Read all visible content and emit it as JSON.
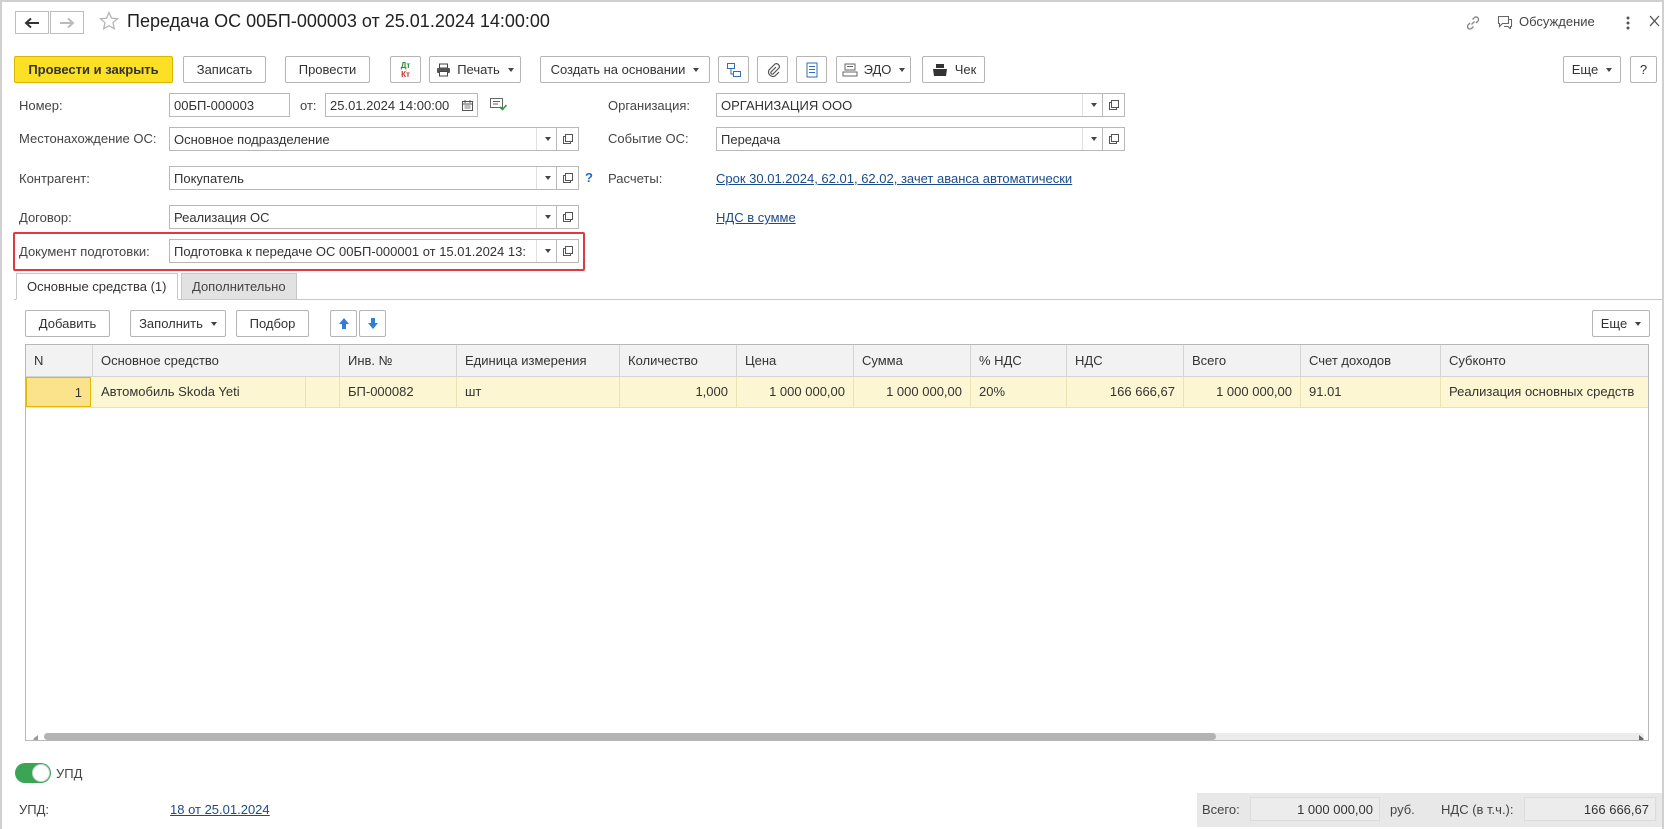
{
  "header": {
    "title": "Передача ОС 00БП-000003 от 25.01.2024 14:00:00",
    "discussion_label": "Обсуждение"
  },
  "toolbar": {
    "post_close": "Провести и закрыть",
    "write": "Записать",
    "post": "Провести",
    "dtkt_top": "Дт",
    "dtkt_bottom": "Кт",
    "print": "Печать",
    "create_based": "Создать на основании",
    "edo": "ЭДО",
    "check": "Чек",
    "more": "Еще",
    "help": "?"
  },
  "form": {
    "number_label": "Номер:",
    "number_value": "00БП-000003",
    "from_label": "от:",
    "date_value": "25.01.2024 14:00:00",
    "location_label": "Местонахождение ОС:",
    "location_value": "Основное подразделение",
    "counterparty_label": "Контрагент:",
    "counterparty_value": "Покупатель",
    "counterparty_help": "?",
    "contract_label": "Договор:",
    "contract_value": "Реализация ОС",
    "prep_doc_label": "Документ подготовки:",
    "prep_doc_value": "Подготовка к передаче ОС 00БП-000001 от 15.01.2024 13:",
    "org_label": "Организация:",
    "org_value": "ОРГАНИЗАЦИЯ ООО",
    "event_label": "Событие ОС:",
    "event_value": "Передача",
    "settlements_label": "Расчеты:",
    "settlements_link": "Срок 30.01.2024, 62.01, 62.02, зачет аванса автоматически",
    "vat_link": "НДС в сумме"
  },
  "tabs": [
    {
      "label": "Основные средства (1)"
    },
    {
      "label": "Дополнительно"
    }
  ],
  "table_toolbar": {
    "add": "Добавить",
    "fill": "Заполнить",
    "pick": "Подбор",
    "more": "Еще"
  },
  "table": {
    "columns": [
      "N",
      "Основное средство",
      "Инв. №",
      "Единица измерения",
      "Количество",
      "Цена",
      "Сумма",
      "% НДС",
      "НДС",
      "Всего",
      "Счет доходов",
      "Субконто"
    ],
    "rows": [
      [
        "1",
        "Автомобиль Skoda Yeti",
        "БП-000082",
        "шт",
        "1,000",
        "1 000 000,00",
        "1 000 000,00",
        "20%",
        "166 666,67",
        "1 000 000,00",
        "91.01",
        "Реализация основных средств"
      ]
    ]
  },
  "footer": {
    "upd_toggle_label": "УПД",
    "upd_label": "УПД:",
    "upd_link": "18 от 25.01.2024",
    "total_label": "Всего:",
    "total_value": "1 000 000,00",
    "currency": "руб.",
    "vat_label": "НДС (в т.ч.):",
    "vat_value": "166 666,67"
  },
  "colors": {
    "primary_button": "#fbe025",
    "selected_row": "#fdf6d3",
    "highlight_frame": "#e0393e",
    "link": "#1b4b8a",
    "toggle_on": "#3aa655"
  }
}
